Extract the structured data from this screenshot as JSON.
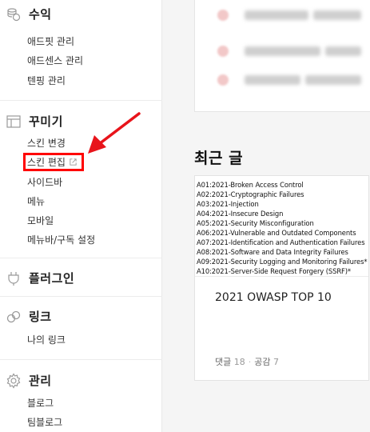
{
  "sidebar": {
    "revenue": {
      "title": "수익",
      "icon": "coins-icon",
      "items": [
        "애드핏 관리",
        "애드센스 관리",
        "텐핑 관리"
      ]
    },
    "customize": {
      "title": "꾸미기",
      "icon": "layout-icon",
      "items": [
        "스킨 변경",
        "스킨 편집",
        "사이드바",
        "메뉴",
        "모바일",
        "메뉴바/구독 설정"
      ]
    },
    "plugin": {
      "title": "플러그인",
      "icon": "plug-icon"
    },
    "link": {
      "title": "링크",
      "icon": "link-icon",
      "items": [
        "나의 링크"
      ]
    },
    "manage": {
      "title": "관리",
      "icon": "gear-icon",
      "items": [
        "블로그",
        "팀블로그"
      ]
    }
  },
  "main": {
    "recent_title": "최근 글",
    "post": {
      "thumbnail_lines": [
        "A01:2021-Broken Access Control",
        "A02:2021-Cryptographic Failures",
        "A03:2021-Injection",
        "A04:2021-Insecure Design",
        "A05:2021-Security Misconfiguration",
        "A06:2021-Vulnerable and Outdated Components",
        "A07:2021-Identification and Authentication Failures",
        "A08:2021-Software and Data Integrity Failures",
        "A09:2021-Security Logging and Monitoring Failures*",
        "A10:2021-Server-Side Request Forgery (SSRF)*"
      ],
      "title": "2021 OWASP TOP 10",
      "comments_label": "댓글",
      "comments_count": "18",
      "likes_label": "공감",
      "likes_count": "7"
    }
  },
  "colors": {
    "highlight": "#ff0000",
    "arrow": "#e8141b"
  }
}
